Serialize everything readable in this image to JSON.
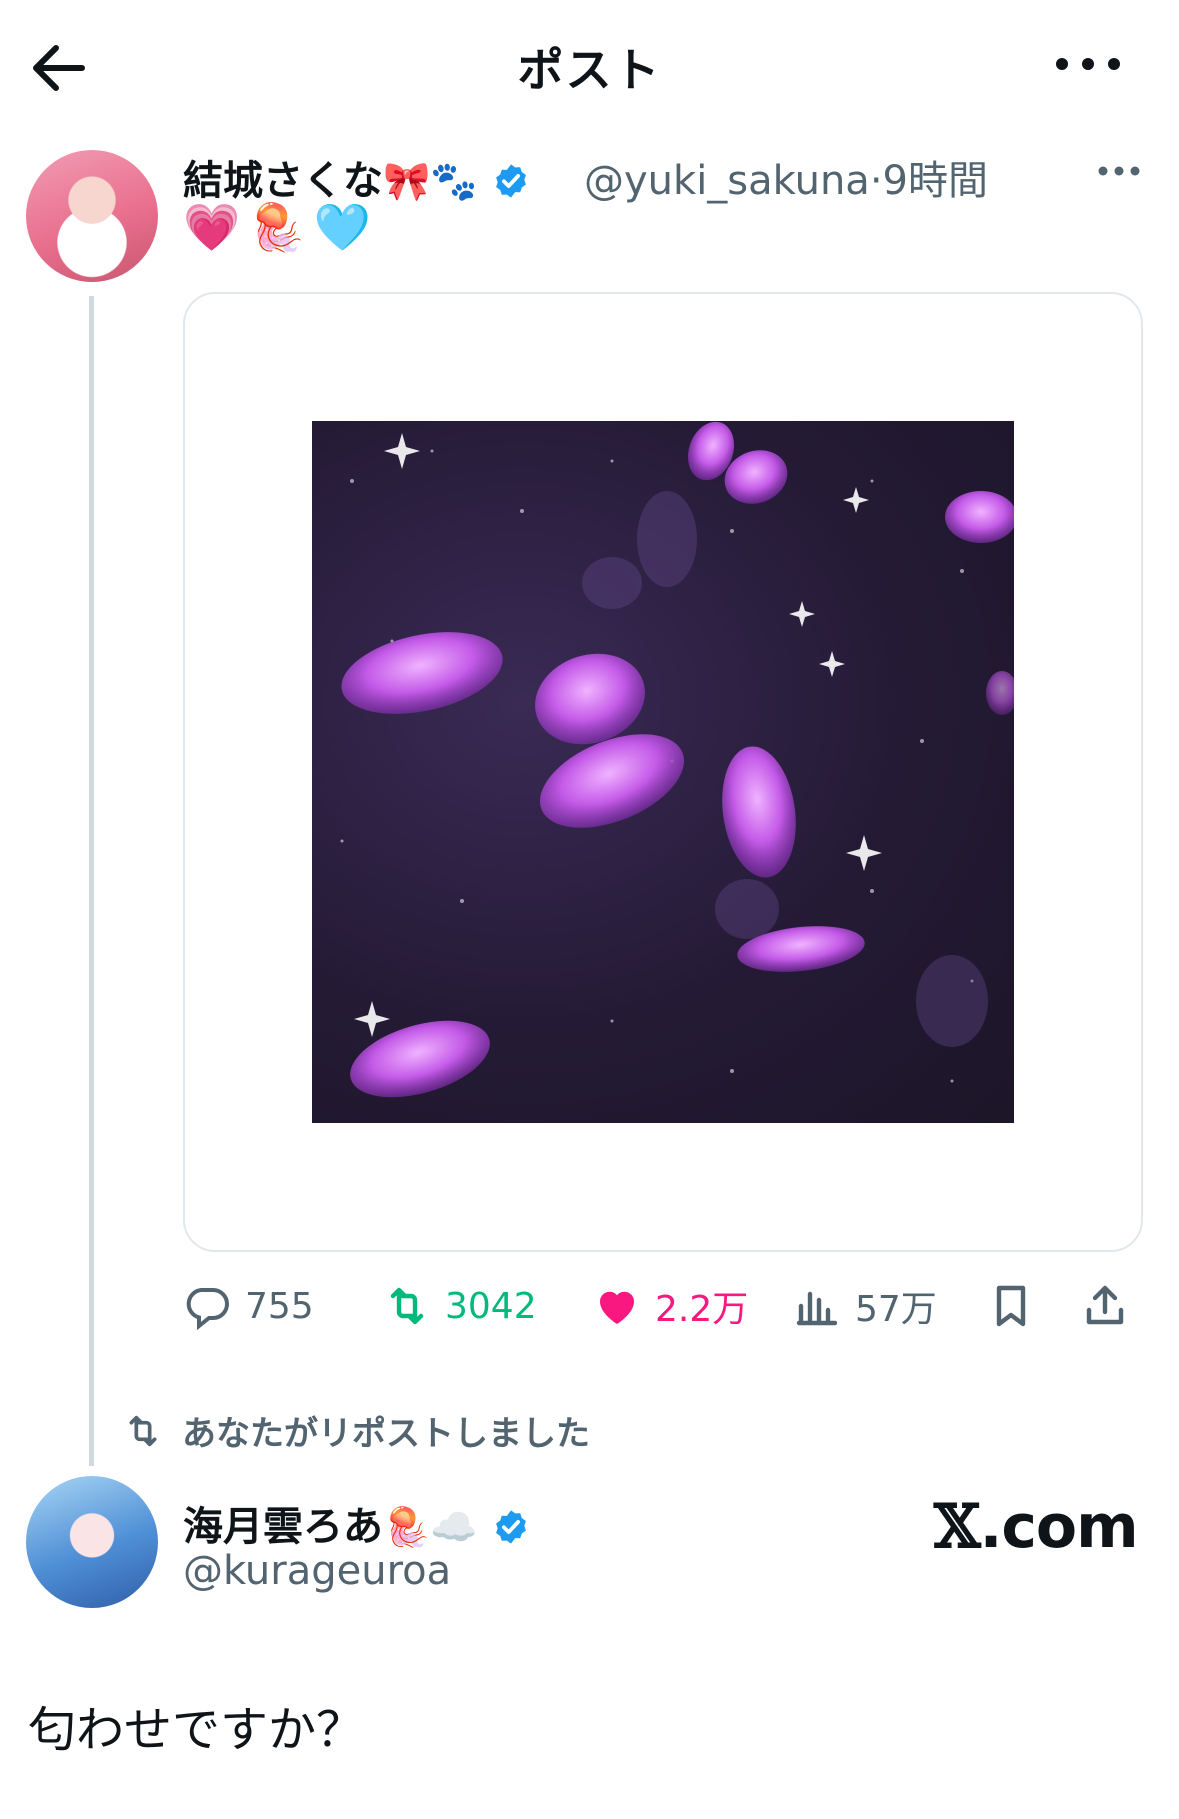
{
  "header": {
    "title": "ポスト"
  },
  "post": {
    "display_name": "結城さくな",
    "name_emojis": [
      "🎀",
      "🐾"
    ],
    "handle": "@yuki_sakuna",
    "separator": "·",
    "time": "9時間",
    "text_emojis": "💗🪼🩵",
    "stats": {
      "replies": "755",
      "reposts": "3042",
      "likes": "2.2万",
      "views": "57万"
    }
  },
  "repost_notice": "あなたがリポストしました",
  "reply": {
    "display_name": "海月雲ろあ",
    "name_emojis": [
      "🪼",
      "☁️"
    ],
    "handle": "@kurageuroa",
    "watermark_x": "𝕏",
    "watermark_domain": ".com",
    "text": "匂わせですか？"
  },
  "colors": {
    "text": "#0f1419",
    "secondary": "#536471",
    "verified": "#1d9bf0",
    "repost_green": "#00ba7c",
    "like_pink": "#f91880",
    "thread_line": "#cfd9de"
  },
  "icons": [
    "back-arrow-icon",
    "more-icon",
    "verified-badge-icon",
    "reply-icon",
    "repost-icon",
    "like-icon",
    "views-icon",
    "bookmark-icon",
    "share-icon"
  ]
}
